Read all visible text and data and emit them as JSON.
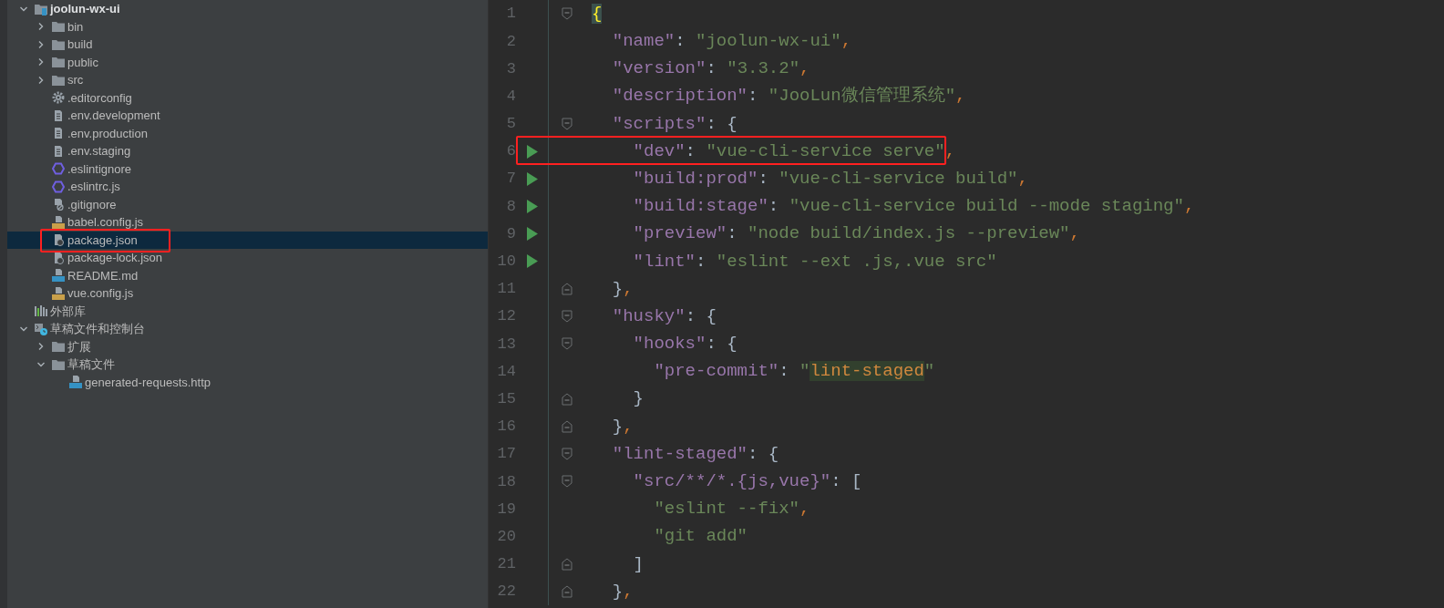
{
  "project_tree": [
    {
      "label": "joolun-wx-ui",
      "kind": "module",
      "expanded": true,
      "selected": false,
      "children": [
        {
          "label": "bin",
          "kind": "folder",
          "expanded": false,
          "selected": false
        },
        {
          "label": "build",
          "kind": "folder",
          "expanded": false,
          "selected": false
        },
        {
          "label": "public",
          "kind": "folder",
          "expanded": false,
          "selected": false
        },
        {
          "label": "src",
          "kind": "folder",
          "expanded": false,
          "selected": false
        },
        {
          "label": ".editorconfig",
          "kind": "gear",
          "selected": false
        },
        {
          "label": ".env.development",
          "kind": "text",
          "selected": false
        },
        {
          "label": ".env.production",
          "kind": "text",
          "selected": false
        },
        {
          "label": ".env.staging",
          "kind": "text",
          "selected": false
        },
        {
          "label": ".eslintignore",
          "kind": "eslint",
          "selected": false
        },
        {
          "label": ".eslintrc.js",
          "kind": "eslint",
          "selected": false
        },
        {
          "label": ".gitignore",
          "kind": "ignore",
          "selected": false
        },
        {
          "label": "babel.config.js",
          "kind": "js",
          "selected": false
        },
        {
          "label": "package.json",
          "kind": "json",
          "selected": true,
          "annotated": true
        },
        {
          "label": "package-lock.json",
          "kind": "json",
          "selected": false
        },
        {
          "label": "README.md",
          "kind": "md",
          "selected": false
        },
        {
          "label": "vue.config.js",
          "kind": "js",
          "selected": false
        }
      ]
    },
    {
      "label": "外部库",
      "kind": "library",
      "selected": false
    },
    {
      "label": "草稿文件和控制台",
      "kind": "scratch",
      "expanded": true,
      "selected": false,
      "children": [
        {
          "label": "扩展",
          "kind": "folder",
          "expanded": false,
          "selected": false
        },
        {
          "label": "草稿文件",
          "kind": "folder",
          "expanded": true,
          "selected": false,
          "children": [
            {
              "label": "generated-requests.http",
              "kind": "api",
              "selected": false
            }
          ]
        }
      ]
    }
  ],
  "editor_lines": [
    {
      "number": "1",
      "kind": "fold-start",
      "tokens": [
        {
          "kind": "brace-match",
          "text": "{"
        }
      ],
      "children": [
        {
          "number": "2",
          "kind": "plain",
          "tokens": [
            {
              "kind": "key",
              "text": "\"name\""
            },
            {
              "kind": "colon",
              "text": ": "
            },
            {
              "kind": "string",
              "text": "\"joolun-wx-ui\""
            },
            {
              "kind": "comma",
              "text": ","
            }
          ]
        },
        {
          "number": "3",
          "kind": "plain",
          "tokens": [
            {
              "kind": "key",
              "text": "\"version\""
            },
            {
              "kind": "colon",
              "text": ": "
            },
            {
              "kind": "string",
              "text": "\"3.3.2\""
            },
            {
              "kind": "comma",
              "text": ","
            }
          ]
        },
        {
          "number": "4",
          "kind": "plain",
          "tokens": [
            {
              "kind": "key",
              "text": "\"description\""
            },
            {
              "kind": "colon",
              "text": ": "
            },
            {
              "kind": "string",
              "text": "\"JooLun微信管理系统\""
            },
            {
              "kind": "comma",
              "text": ","
            }
          ]
        },
        {
          "number": "5",
          "kind": "fold-start",
          "tokens": [
            {
              "kind": "key",
              "text": "\"scripts\""
            },
            {
              "kind": "colon",
              "text": ": "
            },
            {
              "kind": "brace",
              "text": "{"
            }
          ],
          "children": [
            {
              "number": "6",
              "kind": "run",
              "annotated": true,
              "tokens": [
                {
                  "kind": "key",
                  "text": "\"dev\""
                },
                {
                  "kind": "colon",
                  "text": ": "
                },
                {
                  "kind": "string",
                  "text": "\"vue-cli-service serve\""
                },
                {
                  "kind": "comma",
                  "text": ","
                }
              ]
            },
            {
              "number": "7",
              "kind": "run",
              "tokens": [
                {
                  "kind": "key",
                  "text": "\"build:prod\""
                },
                {
                  "kind": "colon",
                  "text": ": "
                },
                {
                  "kind": "string",
                  "text": "\"vue-cli-service build\""
                },
                {
                  "kind": "comma",
                  "text": ","
                }
              ]
            },
            {
              "number": "8",
              "kind": "run",
              "tokens": [
                {
                  "kind": "key",
                  "text": "\"build:stage\""
                },
                {
                  "kind": "colon",
                  "text": ": "
                },
                {
                  "kind": "string",
                  "text": "\"vue-cli-service build --mode staging\""
                },
                {
                  "kind": "comma",
                  "text": ","
                }
              ]
            },
            {
              "number": "9",
              "kind": "run",
              "tokens": [
                {
                  "kind": "key",
                  "text": "\"preview\""
                },
                {
                  "kind": "colon",
                  "text": ": "
                },
                {
                  "kind": "string",
                  "text": "\"node build/index.js --preview\""
                },
                {
                  "kind": "comma",
                  "text": ","
                }
              ]
            },
            {
              "number": "10",
              "kind": "run",
              "tokens": [
                {
                  "kind": "key",
                  "text": "\"lint\""
                },
                {
                  "kind": "colon",
                  "text": ": "
                },
                {
                  "kind": "string",
                  "text": "\"eslint --ext .js,.vue src\""
                }
              ]
            }
          ]
        },
        {
          "number": "11",
          "kind": "fold-end",
          "tokens": [
            {
              "kind": "brace",
              "text": "}"
            },
            {
              "kind": "comma",
              "text": ","
            }
          ]
        },
        {
          "number": "12",
          "kind": "fold-start",
          "tokens": [
            {
              "kind": "key",
              "text": "\"husky\""
            },
            {
              "kind": "colon",
              "text": ": "
            },
            {
              "kind": "brace",
              "text": "{"
            }
          ],
          "children": [
            {
              "number": "13",
              "kind": "fold-start",
              "tokens": [
                {
                  "kind": "key",
                  "text": "\"hooks\""
                },
                {
                  "kind": "colon",
                  "text": ": "
                },
                {
                  "kind": "brace",
                  "text": "{"
                }
              ],
              "children": [
                {
                  "number": "14",
                  "kind": "plain",
                  "tokens": [
                    {
                      "kind": "key",
                      "text": "\"pre-commit\""
                    },
                    {
                      "kind": "colon",
                      "text": ": "
                    },
                    {
                      "kind": "string",
                      "text": "\""
                    },
                    {
                      "kind": "match",
                      "text": "lint-staged"
                    },
                    {
                      "kind": "string",
                      "text": "\""
                    }
                  ]
                }
              ]
            },
            {
              "number": "15",
              "kind": "fold-end",
              "tokens": [
                {
                  "kind": "brace",
                  "text": "}"
                }
              ]
            }
          ]
        },
        {
          "number": "16",
          "kind": "fold-end",
          "tokens": [
            {
              "kind": "brace",
              "text": "}"
            },
            {
              "kind": "comma",
              "text": ","
            }
          ]
        },
        {
          "number": "17",
          "kind": "fold-start",
          "tokens": [
            {
              "kind": "key",
              "text": "\"lint-staged\""
            },
            {
              "kind": "colon",
              "text": ": "
            },
            {
              "kind": "brace",
              "text": "{"
            }
          ],
          "children": [
            {
              "number": "18",
              "kind": "fold-start",
              "tokens": [
                {
                  "kind": "key",
                  "text": "\"src/**/*.{js,vue}\""
                },
                {
                  "kind": "colon",
                  "text": ": "
                },
                {
                  "kind": "brace",
                  "text": "["
                }
              ],
              "children": [
                {
                  "number": "19",
                  "kind": "plain",
                  "tokens": [
                    {
                      "kind": "string",
                      "text": "\"eslint --fix\""
                    },
                    {
                      "kind": "comma",
                      "text": ","
                    }
                  ]
                },
                {
                  "number": "20",
                  "kind": "plain",
                  "tokens": [
                    {
                      "kind": "string",
                      "text": "\"git add\""
                    }
                  ]
                }
              ]
            },
            {
              "number": "21",
              "kind": "fold-end",
              "tokens": [
                {
                  "kind": "brace",
                  "text": "]"
                }
              ]
            }
          ]
        },
        {
          "number": "22",
          "kind": "fold-end",
          "tokens": [
            {
              "kind": "brace",
              "text": "}"
            },
            {
              "kind": "comma",
              "text": ","
            }
          ]
        }
      ]
    }
  ]
}
